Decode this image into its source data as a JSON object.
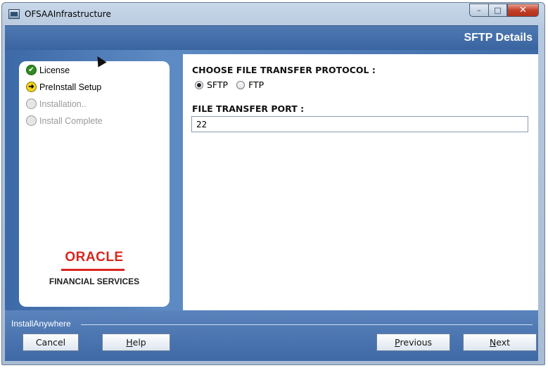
{
  "window": {
    "title": "OFSAAInfrastructure",
    "controls": {
      "minimize": "–",
      "maximize": "□",
      "close": "✕"
    }
  },
  "header": {
    "title": "SFTP Details"
  },
  "steps": [
    {
      "label": "License",
      "state": "done",
      "icon": "check-icon",
      "glyph": "✔"
    },
    {
      "label": "PreInstall Setup",
      "state": "current",
      "icon": "arrow-right-icon",
      "glyph": "➜"
    },
    {
      "label": "Installation..",
      "state": "pending",
      "icon": "circle-icon",
      "glyph": ""
    },
    {
      "label": "Install Complete",
      "state": "pending",
      "icon": "circle-icon",
      "glyph": ""
    }
  ],
  "branding": {
    "logo": "ORACLE",
    "subtitle": "FINANCIAL SERVICES"
  },
  "form": {
    "protocol_label": "CHOOSE FILE TRANSFER PROTOCOL :",
    "protocol_options": [
      {
        "label": "SFTP",
        "checked": true
      },
      {
        "label": "FTP",
        "checked": false
      }
    ],
    "port_label": "FILE TRANSFER PORT :",
    "port_value": "22"
  },
  "footer": {
    "brand": "InstallAnywhere",
    "buttons": {
      "cancel": "Cancel",
      "help_u": "H",
      "help_rest": "elp",
      "previous_u": "P",
      "previous_rest": "revious",
      "next_u": "N",
      "next_rest": "ext"
    }
  },
  "colors": {
    "header_blue": "#3a649f",
    "oracle_red": "#d8261d",
    "step_done": "#2f8a22",
    "step_current": "#f3d31b"
  }
}
